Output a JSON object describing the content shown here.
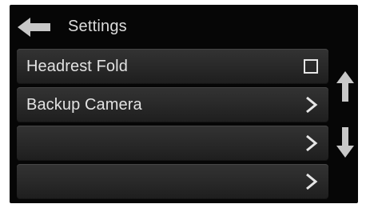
{
  "header": {
    "title": "Settings",
    "back_icon": "back-arrow-icon"
  },
  "rows": [
    {
      "label": "Headrest Fold",
      "control": "checkbox",
      "checked": false,
      "icon": "checkbox-icon"
    },
    {
      "label": "Backup Camera",
      "control": "chevron",
      "icon": "chevron-right-icon"
    },
    {
      "label": "",
      "control": "chevron",
      "icon": "chevron-right-icon"
    },
    {
      "label": "",
      "control": "chevron",
      "icon": "chevron-right-icon"
    }
  ],
  "scroll": {
    "up_icon": "arrow-up-icon",
    "down_icon": "arrow-down-icon"
  },
  "colors": {
    "background": "#060606",
    "row": "#2a2a2a",
    "text": "#e2e2e2",
    "icon": "#c8c8c8"
  }
}
